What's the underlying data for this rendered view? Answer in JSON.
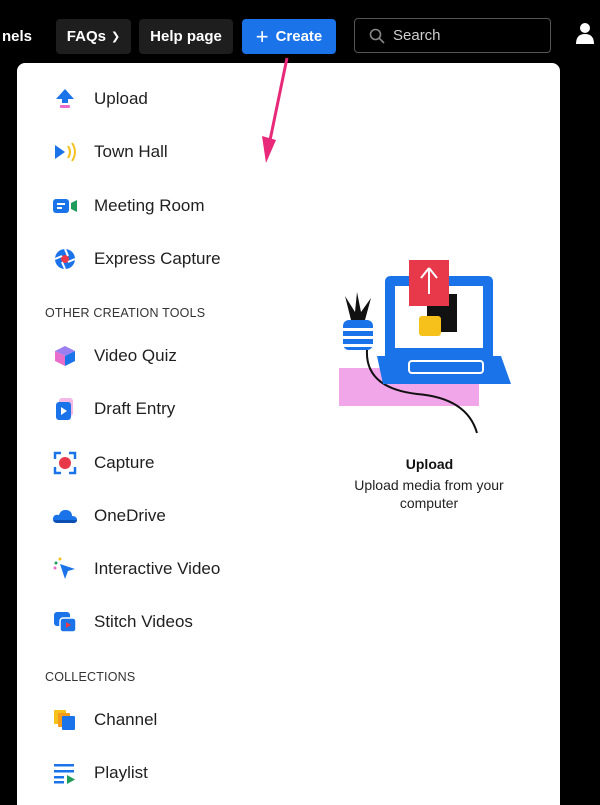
{
  "topbar": {
    "channels_label": "nels",
    "faqs_label": "FAQs",
    "help_label": "Help page",
    "create_label": "Create",
    "search_placeholder": "Search"
  },
  "menu": {
    "primary": [
      {
        "label": "Upload",
        "icon": "upload-icon"
      },
      {
        "label": "Town Hall",
        "icon": "town-hall-icon"
      },
      {
        "label": "Meeting Room",
        "icon": "meeting-room-icon"
      },
      {
        "label": "Express Capture",
        "icon": "express-capture-icon"
      }
    ],
    "other_tools_heading": "OTHER CREATION TOOLS",
    "other_tools": [
      {
        "label": "Video Quiz",
        "icon": "video-quiz-icon"
      },
      {
        "label": "Draft Entry",
        "icon": "draft-entry-icon"
      },
      {
        "label": "Capture",
        "icon": "capture-icon"
      },
      {
        "label": "OneDrive",
        "icon": "onedrive-icon"
      },
      {
        "label": "Interactive Video",
        "icon": "interactive-video-icon"
      },
      {
        "label": "Stitch Videos",
        "icon": "stitch-videos-icon"
      }
    ],
    "collections_heading": "COLLECTIONS",
    "collections": [
      {
        "label": "Channel",
        "icon": "channel-icon"
      },
      {
        "label": "Playlist",
        "icon": "playlist-icon"
      }
    ]
  },
  "preview": {
    "title": "Upload",
    "description": "Upload media from your computer"
  },
  "colors": {
    "accent": "#1a73e8",
    "annotation_arrow": "#e8297a"
  }
}
